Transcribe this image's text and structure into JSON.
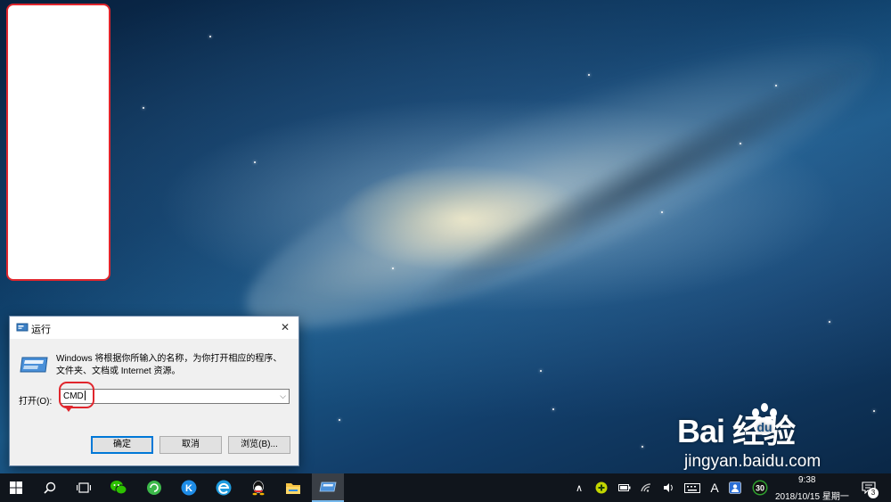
{
  "run_dialog": {
    "title": "运行",
    "description": "Windows 将根据你所输入的名称，为你打开相应的程序、文件夹、文档或 Internet 资源。",
    "open_label": "打开(O):",
    "input_value": "CMD",
    "ok_label": "确定",
    "cancel_label": "取消",
    "browse_label": "浏览(B)...",
    "close_glyph": "✕"
  },
  "watermark": {
    "logo_text": "Bai   经验",
    "url": "jingyan.baidu.com"
  },
  "taskbar": {
    "items": [
      {
        "name": "start-button",
        "icon": "windows-icon"
      },
      {
        "name": "search-button",
        "icon": "search-icon"
      },
      {
        "name": "task-view-button",
        "icon": "task-view-icon"
      },
      {
        "name": "wechat-app",
        "icon": "wechat-icon"
      },
      {
        "name": "green-app",
        "icon": "refresh-icon"
      },
      {
        "name": "kugou-app",
        "icon": "kugou-icon",
        "glyph": "K"
      },
      {
        "name": "ie-app",
        "icon": "ie-icon"
      },
      {
        "name": "qq-app",
        "icon": "qq-icon"
      },
      {
        "name": "file-explorer-app",
        "icon": "folder-icon"
      },
      {
        "name": "run-app",
        "icon": "run-icon"
      }
    ],
    "tray": {
      "chevron": "∧",
      "ime_indicator": "A",
      "badge_number": "30",
      "time": "9:38",
      "date": "2018/10/15 星期一",
      "notification_count": "3"
    }
  }
}
